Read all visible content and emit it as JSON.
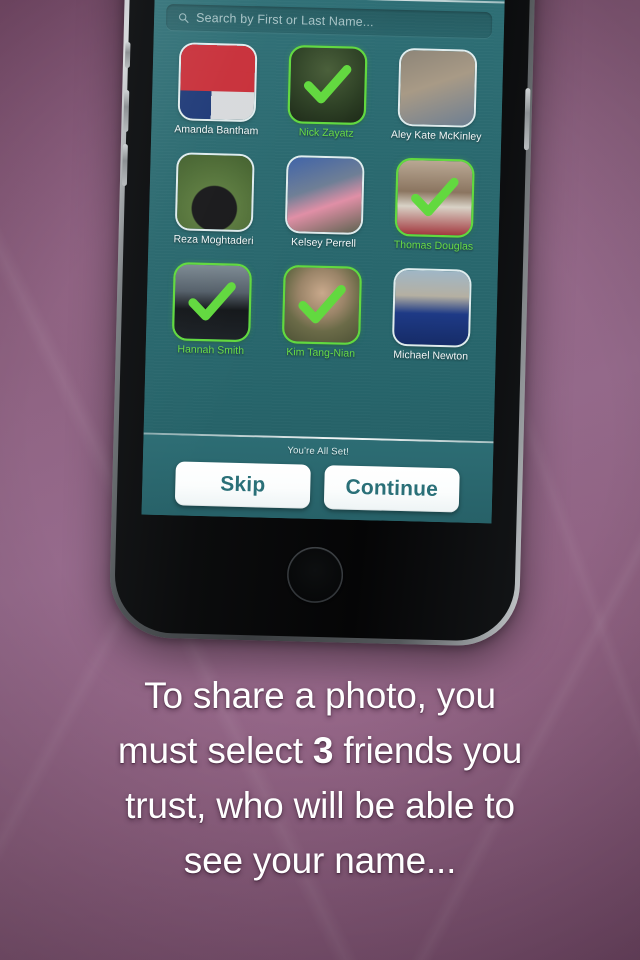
{
  "background": {
    "color_top": "#7e4f6f",
    "color_mid": "#94698a",
    "color_bottom": "#744968"
  },
  "device": {
    "name": "smartphone-mockup",
    "frame_color": "#3a3d40",
    "bezel_color": "#0b0c0d"
  },
  "app": {
    "accent_teal": "#2a696f",
    "accent_green": "#62d93f",
    "pager": {
      "total": 4,
      "active_index": 2,
      "dots": [
        "page-1",
        "page-2",
        "page-3",
        "page-4"
      ]
    },
    "search": {
      "icon": "search-icon",
      "placeholder": "Search by First or Last Name...",
      "value": ""
    },
    "friends": [
      {
        "name": "Amanda Bantham",
        "selected": false,
        "photo": "flag-portrait"
      },
      {
        "name": "Nick Zayatz",
        "selected": true,
        "photo": "man-outdoors-greenery"
      },
      {
        "name": "Aley Kate McKinley",
        "selected": false,
        "photo": "girl-curly-hair-building"
      },
      {
        "name": "Reza Moghtaderi",
        "selected": false,
        "photo": "man-black-shirt-trees"
      },
      {
        "name": "Kelsey Perrell",
        "selected": false,
        "photo": "two-women-hugging"
      },
      {
        "name": "Thomas Douglas",
        "selected": true,
        "photo": "spaniel-dog-on-bed"
      },
      {
        "name": "Hannah Smith",
        "selected": true,
        "photo": "woman-jersey-stadium"
      },
      {
        "name": "Kim Tang-Nian",
        "selected": true,
        "photo": "woman-olive-top"
      },
      {
        "name": "Michael Newton",
        "selected": false,
        "photo": "graduation-couple"
      }
    ],
    "footer": {
      "status_text": "You're All Set!",
      "skip_label": "Skip",
      "continue_label": "Continue"
    }
  },
  "caption": {
    "line1": "To share a photo, you",
    "line2_before": "must select ",
    "line2_strong": "3",
    "line2_after": " friends you",
    "line3": "trust, who will be able to",
    "line4": "see your name..."
  }
}
